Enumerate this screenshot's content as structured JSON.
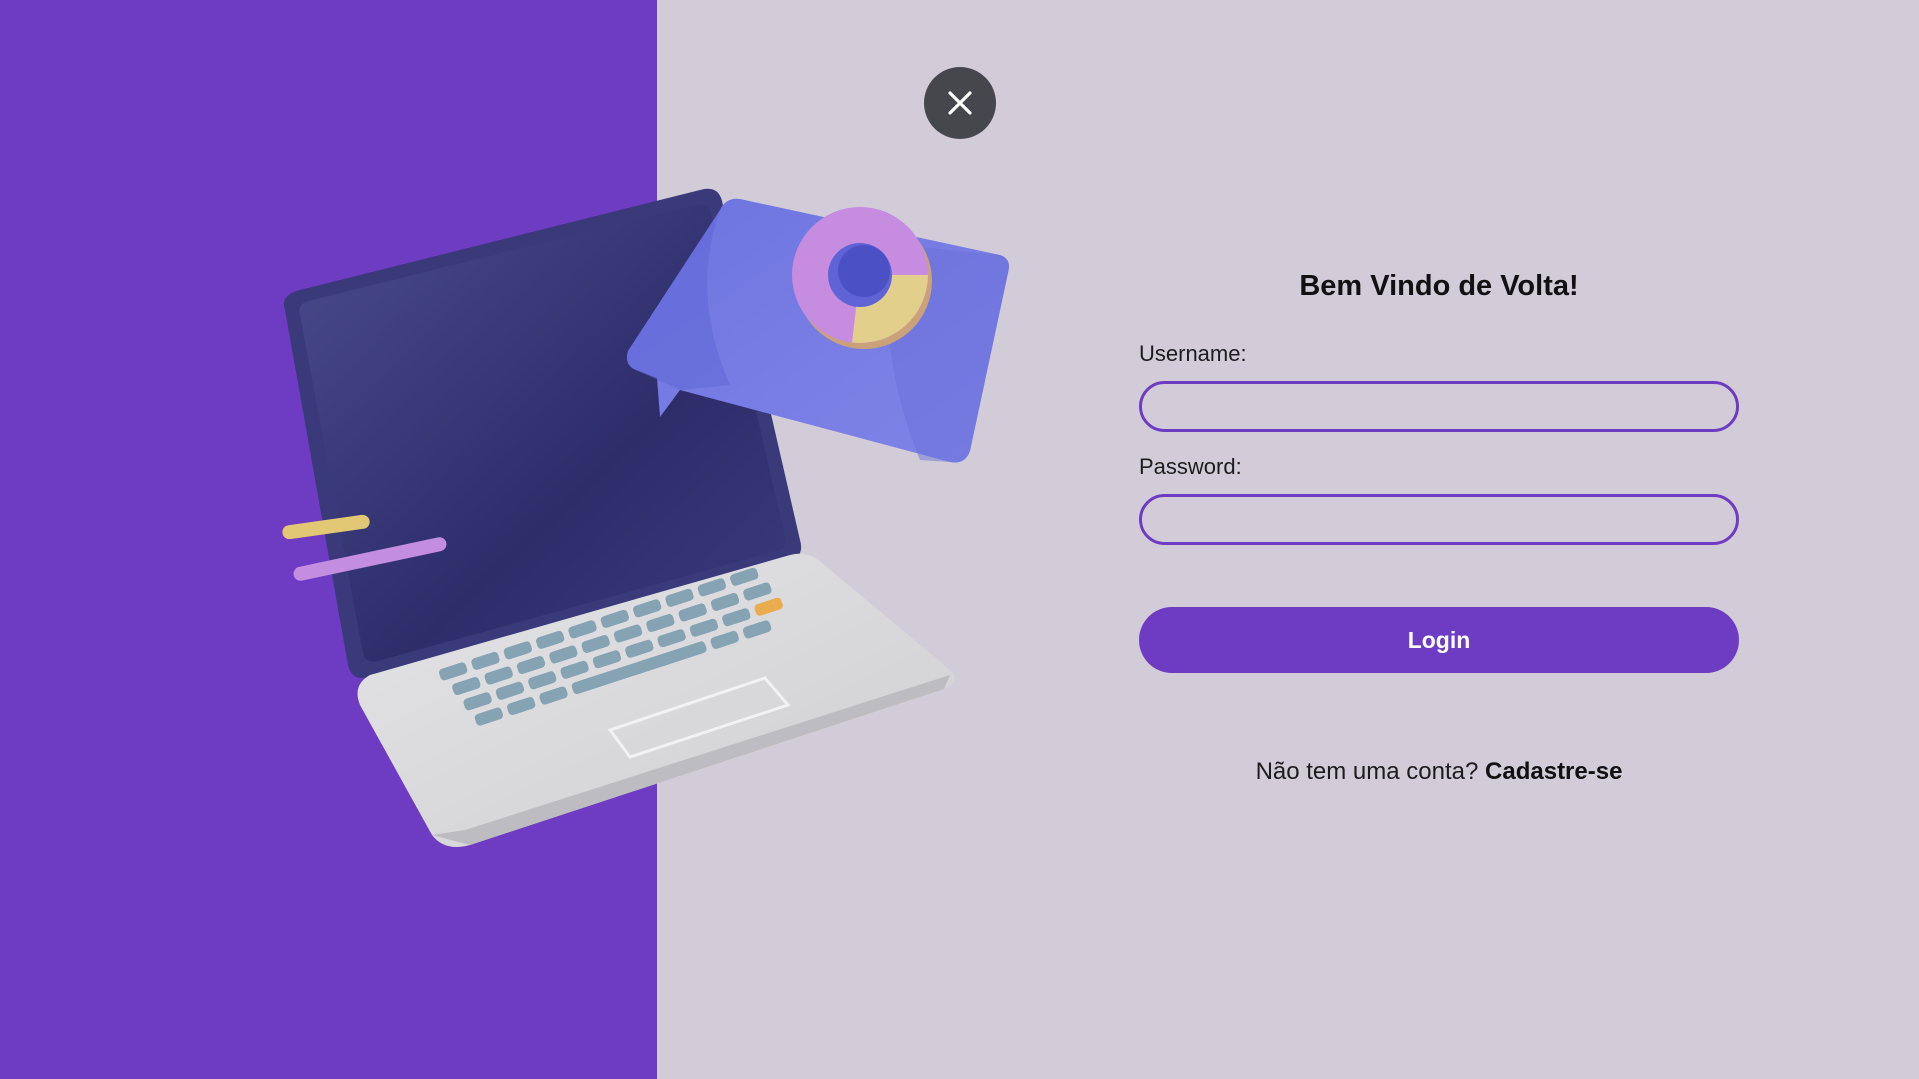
{
  "colors": {
    "accent": "#6e3bc3",
    "background": "#d2ccd9",
    "close_button": "#45474d"
  },
  "illustration": {
    "name": "laptop-with-chart-illustration"
  },
  "close": {
    "icon": "close-icon"
  },
  "login_form": {
    "title": "Bem Vindo de Volta!",
    "username_label": "Username:",
    "username_value": "",
    "password_label": "Password:",
    "password_value": "",
    "submit_label": "Login",
    "signup_prompt": "Não tem uma conta?",
    "signup_link": "Cadastre-se"
  }
}
